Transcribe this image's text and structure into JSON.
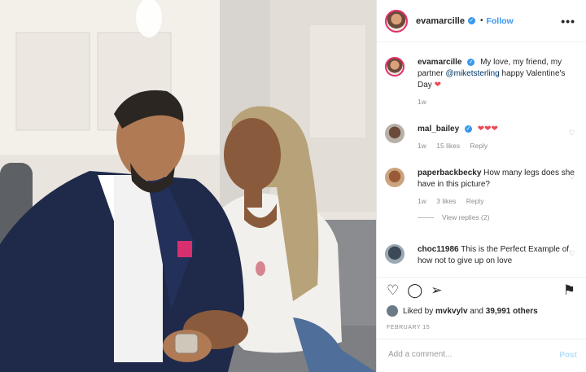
{
  "post": {
    "author": "evamarcille",
    "follow_label": "Follow",
    "more_label": "•••"
  },
  "caption": {
    "username": "evamarcille",
    "text_before": "My love, my friend, my partner",
    "mention": "@miketsterling",
    "text_after": "happy Valentine's Day",
    "emoji": "❤",
    "time": "1w"
  },
  "comments": [
    {
      "username": "mal_bailey",
      "text": "❤❤❤",
      "time": "1w",
      "likes": "15 likes",
      "reply": "Reply"
    },
    {
      "username": "paperbackbecky",
      "text": "How many legs does she have in this picture?",
      "time": "1w",
      "likes": "3 likes",
      "reply": "Reply",
      "view_replies": "View replies (2)"
    },
    {
      "username": "choc11986",
      "text": "This is the Perfect Example of how not to give up on love"
    }
  ],
  "actions": {
    "liked_by_prefix": "Liked by",
    "liked_by_user": "mvkvylv",
    "liked_by_mid": "and",
    "liked_by_count": "39,991 others",
    "date": "FEBRUARY 15"
  },
  "add_comment": {
    "placeholder": "Add a comment...",
    "post_label": "Post"
  },
  "colors": {
    "accent": "#3897f0",
    "heart": "#ed4956"
  }
}
